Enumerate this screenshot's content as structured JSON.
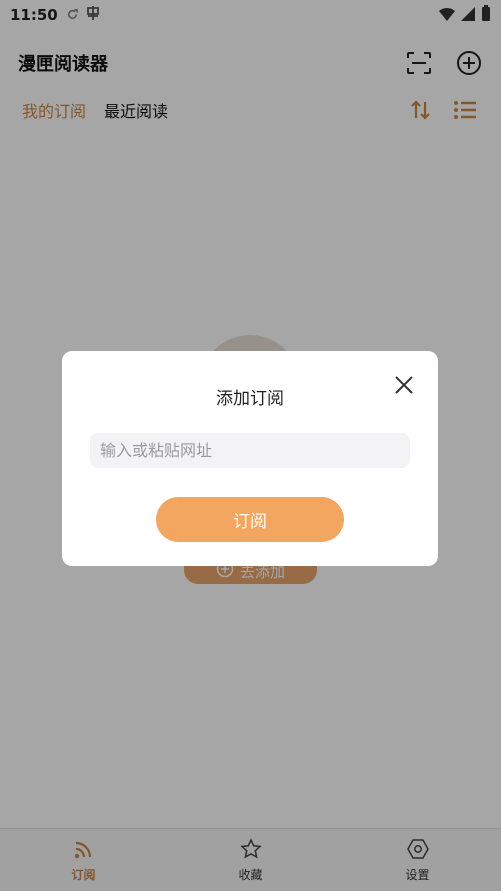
{
  "status_bar": {
    "time": "11:50",
    "left_icons": [
      "sync-icon",
      "notification-icon"
    ],
    "right_icons": [
      "wifi-icon",
      "signal-icon",
      "battery-icon"
    ]
  },
  "header": {
    "title": "漫匣阅读器",
    "actions": [
      "scan-icon",
      "add-circle-icon"
    ]
  },
  "tabs": {
    "items": [
      {
        "label": "我的订阅",
        "active": true
      },
      {
        "label": "最近阅读",
        "active": false
      }
    ],
    "actions": [
      "sort-icon",
      "list-icon"
    ]
  },
  "empty_state": {
    "button_label": "去添加",
    "icon": "add-icon"
  },
  "bottom_nav": {
    "items": [
      {
        "label": "订阅",
        "icon": "rss-icon",
        "active": true
      },
      {
        "label": "收藏",
        "icon": "star-icon",
        "active": false
      },
      {
        "label": "设置",
        "icon": "settings-icon",
        "active": false
      }
    ]
  },
  "dialog": {
    "title": "添加订阅",
    "input_placeholder": "输入或粘贴网址",
    "input_value": "",
    "submit_label": "订阅"
  },
  "colors": {
    "accent": "#c8864a",
    "button": "#f2a65f",
    "overlay": "rgba(0,0,0,0.35)"
  }
}
